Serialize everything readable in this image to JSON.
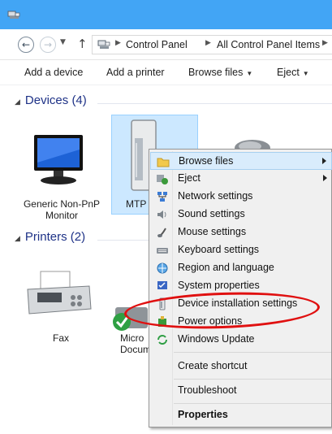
{
  "address": {
    "crumbs": [
      "Control Panel",
      "All Control Panel Items"
    ]
  },
  "commands": [
    {
      "label": "Add a device",
      "dropdown": false
    },
    {
      "label": "Add a printer",
      "dropdown": false
    },
    {
      "label": "Browse files",
      "dropdown": true
    },
    {
      "label": "Eject",
      "dropdown": true
    }
  ],
  "groups": {
    "devices": "Devices (4)",
    "printers": "Printers (2)"
  },
  "devices": [
    {
      "line1": "Generic Non-PnP",
      "line2": "Monitor",
      "icon": "monitor-icon"
    },
    {
      "line1": "MTP",
      "line2": "",
      "icon": "drive-icon",
      "selected": true
    }
  ],
  "printers": [
    {
      "line1": "Fax",
      "line2": "",
      "icon": "fax-icon"
    },
    {
      "line1": "Micro",
      "line2": "Docum",
      "icon": "printer-icon"
    }
  ],
  "context_menu": {
    "items": [
      {
        "label": "Browse files",
        "icon": "folder-icon",
        "submenu": true,
        "highlighted": true
      },
      {
        "label": "Eject",
        "icon": "eject-icon",
        "submenu": true
      },
      {
        "label": "Network settings",
        "icon": "network-icon"
      },
      {
        "label": "Sound settings",
        "icon": "speaker-icon"
      },
      {
        "label": "Mouse settings",
        "icon": "mouse-icon"
      },
      {
        "label": "Keyboard settings",
        "icon": "keyboard-icon"
      },
      {
        "label": "Region and language",
        "icon": "globe-icon"
      },
      {
        "label": "System properties",
        "icon": "system-icon"
      },
      {
        "label": "Device installation settings",
        "icon": "device-install-icon"
      },
      {
        "label": "Power options",
        "icon": "power-icon"
      },
      {
        "label": "Windows Update",
        "icon": "windows-update-icon"
      },
      {
        "label": "Create shortcut"
      },
      {
        "label": "Troubleshoot"
      },
      {
        "label": "Properties",
        "bold": true
      }
    ]
  },
  "colors": {
    "titlebar": "#42a5f5",
    "group_header": "#1e3287",
    "selection": "#cce8ff",
    "highlight_circle": "#e01010"
  }
}
